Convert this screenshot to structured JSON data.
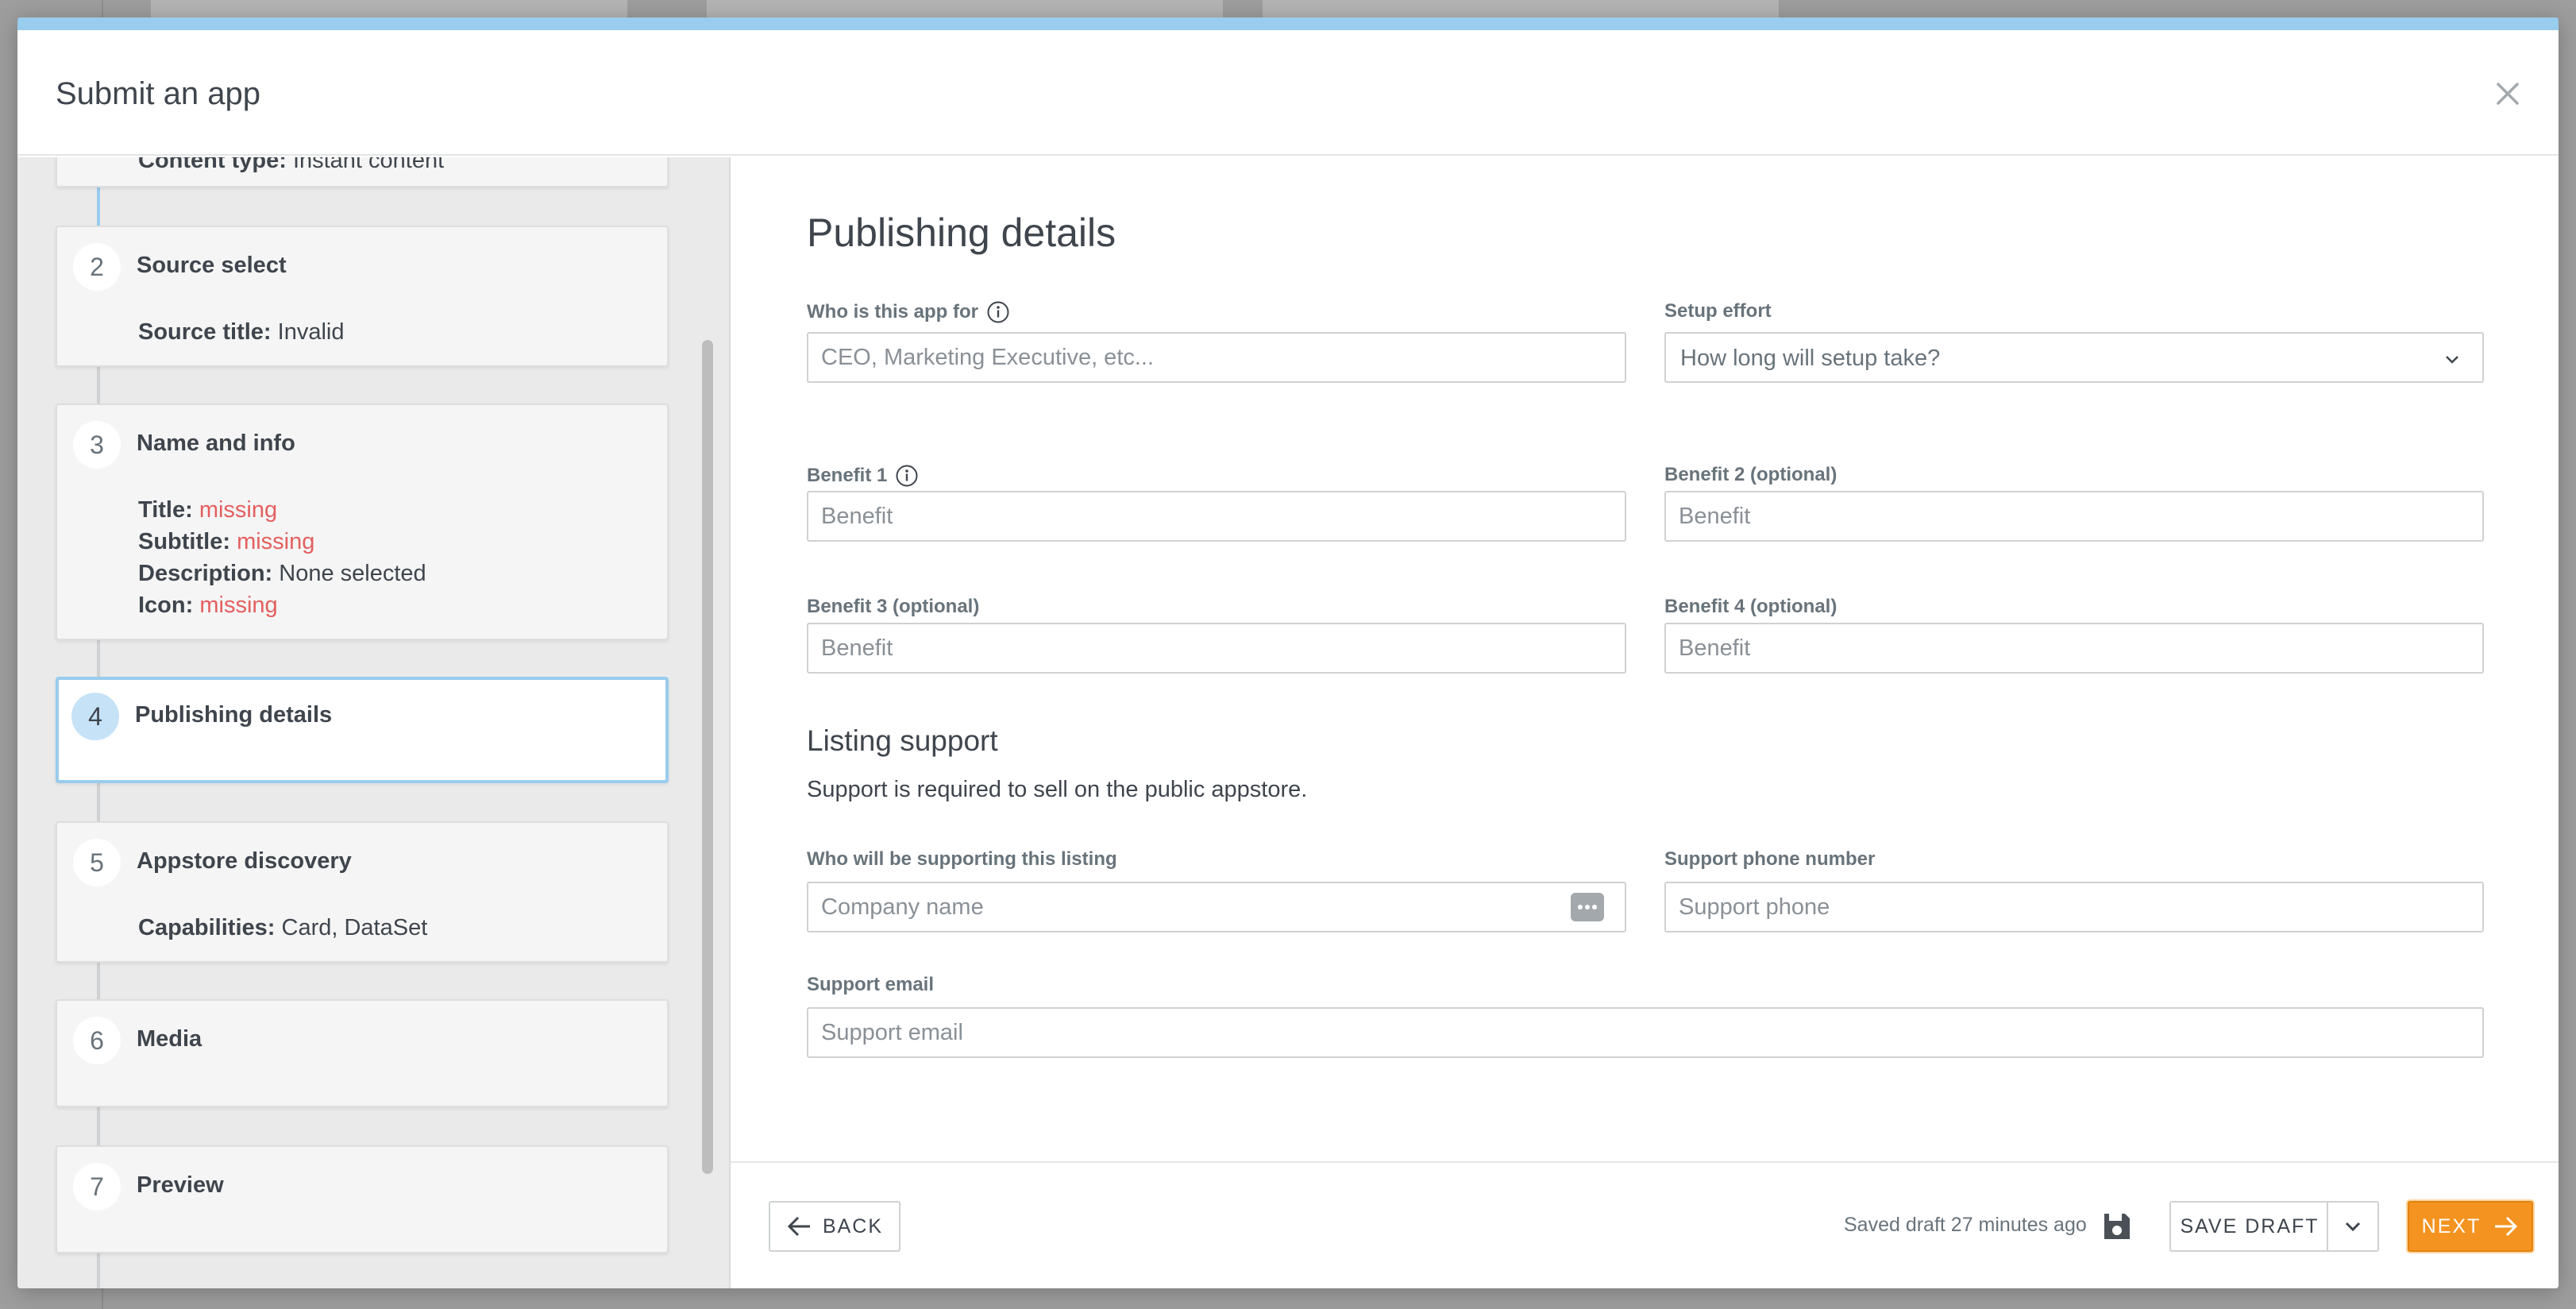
{
  "modal": {
    "title": "Submit an app"
  },
  "steps": [
    {
      "number": "",
      "title": "",
      "details": [
        {
          "key": "Content type:",
          "value": "Instant content",
          "missing": false
        }
      ]
    },
    {
      "number": "2",
      "title": "Source select",
      "details": [
        {
          "key": "Source title:",
          "value": "Invalid",
          "missing": false
        }
      ]
    },
    {
      "number": "3",
      "title": "Name and info",
      "details": [
        {
          "key": "Title:",
          "value": "missing",
          "missing": true
        },
        {
          "key": "Subtitle:",
          "value": "missing",
          "missing": true
        },
        {
          "key": "Description:",
          "value": "None selected",
          "missing": false
        },
        {
          "key": "Icon:",
          "value": "missing",
          "missing": true
        }
      ]
    },
    {
      "number": "4",
      "title": "Publishing details",
      "active": true,
      "details": []
    },
    {
      "number": "5",
      "title": "Appstore discovery",
      "details": [
        {
          "key": "Capabilities:",
          "value": "Card, DataSet",
          "missing": false
        }
      ]
    },
    {
      "number": "6",
      "title": "Media",
      "details": []
    },
    {
      "number": "7",
      "title": "Preview",
      "details": []
    }
  ],
  "form": {
    "title": "Publishing details",
    "who_for": {
      "label": "Who is this app for",
      "placeholder": "CEO, Marketing Executive, etc..."
    },
    "setup_effort": {
      "label": "Setup effort",
      "placeholder": "How long will setup take?"
    },
    "benefit1": {
      "label": "Benefit 1",
      "placeholder": "Benefit"
    },
    "benefit2": {
      "label": "Benefit 2 (optional)",
      "placeholder": "Benefit"
    },
    "benefit3": {
      "label": "Benefit 3 (optional)",
      "placeholder": "Benefit"
    },
    "benefit4": {
      "label": "Benefit 4 (optional)",
      "placeholder": "Benefit"
    },
    "listing_support": {
      "title": "Listing support",
      "helper": "Support is required to sell on the public appstore.",
      "supporter": {
        "label": "Who will be supporting this listing",
        "placeholder": "Company name"
      },
      "phone": {
        "label": "Support phone number",
        "placeholder": "Support phone"
      },
      "email": {
        "label": "Support email",
        "placeholder": "Support email"
      }
    }
  },
  "footer": {
    "back_label": "BACK",
    "saved_text": "Saved draft 27 minutes ago",
    "save_draft_label": "SAVE DRAFT",
    "next_label": "NEXT"
  },
  "colors": {
    "accent": "#99ccee",
    "next": "#f4931f",
    "missing": "#e45f5f"
  },
  "icons": [
    "close-icon",
    "info-icon",
    "chevron-down-icon",
    "more-icon",
    "arrow-left-icon",
    "save-icon",
    "arrow-right-icon"
  ]
}
